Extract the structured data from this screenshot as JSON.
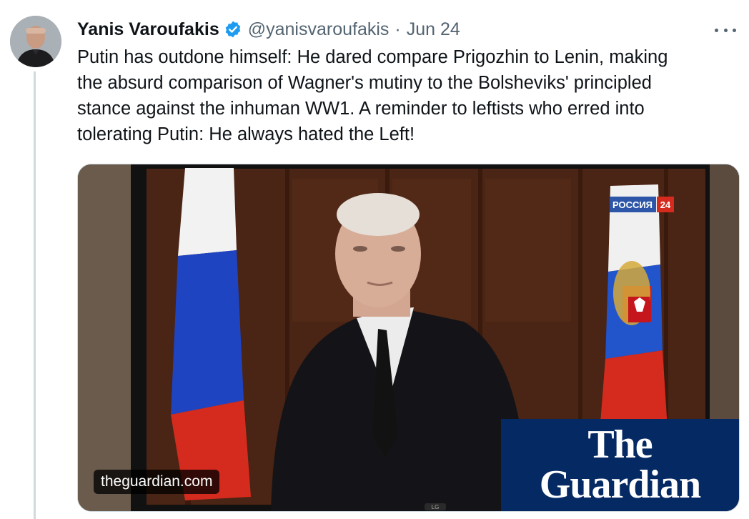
{
  "author": {
    "name": "Yanis Varoufakis",
    "handle": "@yanisvaroufakis",
    "separator": "·",
    "date": "Jun 24",
    "verified": true,
    "verified_color": "#1d9bf0"
  },
  "tweet": {
    "lines": [
      "Putin has outdone himself: He dared compare Prigozhin to Lenin, making",
      "the absurd comparison of Wagner's mutiny to the Bolsheviks' principled",
      "stance against the inhuman WW1. A reminder to leftists who erred into",
      "tolerating Putin: He always hated the Left!"
    ]
  },
  "media": {
    "domain": "theguardian.com",
    "tv_channel_label": "РОССИЯ",
    "tv_channel_number": "24",
    "tv_brand": "LG",
    "logo_line1": "The",
    "logo_line2": "Guardian",
    "logo_bg": "#052962"
  },
  "icons": {
    "more": "more-horizontal-icon",
    "verified": "verified-badge-icon"
  }
}
